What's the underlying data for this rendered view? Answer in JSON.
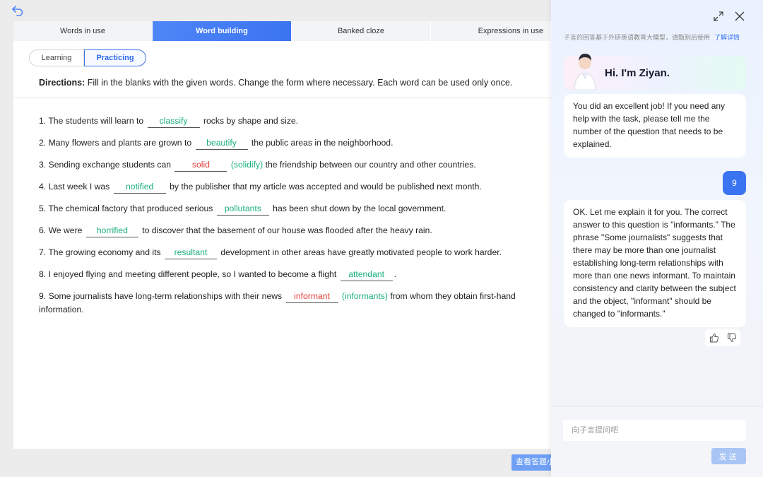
{
  "header": {
    "back_icon": "back-arrow-icon"
  },
  "tabs": [
    {
      "label": "Words in use",
      "active": false
    },
    {
      "label": "Word building",
      "active": true
    },
    {
      "label": "Banked cloze",
      "active": false
    },
    {
      "label": "Expressions in use",
      "active": false
    }
  ],
  "mode": {
    "learning": "Learning",
    "practicing": "Practicing",
    "selected": "Practicing"
  },
  "directions": {
    "label": "Directions:",
    "text": "Fill in the blanks with the given words. Change the form where necessary. Each word can be used only once."
  },
  "questions": [
    {
      "num": "1.",
      "before": "The students will learn to",
      "answer": "classify",
      "status": "correct",
      "correction": "",
      "after": "rocks by shape and size."
    },
    {
      "num": "2.",
      "before": "Many flowers and plants are grown to",
      "answer": "beautify",
      "status": "correct",
      "correction": "",
      "after": "the public areas in the neighborhood."
    },
    {
      "num": "3.",
      "before": "Sending exchange students can",
      "answer": "solid",
      "status": "wrong",
      "correction": "(solidify)",
      "after": "the friendship between our country and other countries."
    },
    {
      "num": "4.",
      "before": "Last week I was",
      "answer": "notified",
      "status": "correct",
      "correction": "",
      "after": "by the publisher that my article was accepted and would be published next month."
    },
    {
      "num": "5.",
      "before": "The chemical factory that produced serious",
      "answer": "pollutants",
      "status": "correct",
      "correction": "",
      "after": "has been shut down by the local government."
    },
    {
      "num": "6.",
      "before": "We were",
      "answer": "horrified",
      "status": "correct",
      "correction": "",
      "after": "to discover that the basement of our house was flooded after the heavy rain."
    },
    {
      "num": "7.",
      "before": "The growing economy and its",
      "answer": "resultant",
      "status": "correct",
      "correction": "",
      "after": "development in other areas have greatly motivated people to work harder."
    },
    {
      "num": "8.",
      "before": "I enjoyed flying and meeting different people, so I wanted to become a flight",
      "answer": "attendant",
      "status": "correct",
      "correction": "",
      "after": "."
    },
    {
      "num": "9.",
      "before": "Some journalists have long-term relationships with their news",
      "answer": "informant",
      "status": "wrong",
      "correction": "(informants)",
      "after": "from whom they obtain first-hand information."
    }
  ],
  "footer": {
    "check_button": "查看答题小"
  },
  "chat": {
    "disclaimer": "子言的回答基于外研英语教育大模型，请甄别后使用",
    "disclaimer_link": "了解详情",
    "greeting": "Hi. I'm Ziyan.",
    "messages": [
      {
        "role": "assistant",
        "text": "You did an excellent job! If you need any help with the task, please tell me the number of the question that needs to be explained."
      },
      {
        "role": "user",
        "text": "9"
      },
      {
        "role": "assistant",
        "text": "OK. Let me explain it for you. The correct answer to this question is \"informants.\" The phrase \"Some journalists\" suggests that there may be more than one journalist establishing long-term relationships with more than one news informant. To maintain consistency and clarity between the subject and the object, \"informant\" should be changed to \"informants.\""
      }
    ],
    "input_placeholder": "向子言提问吧",
    "send_label": "发送"
  },
  "colors": {
    "accent": "#3b74f0",
    "correct": "#1bb07a",
    "wrong": "#e2413d"
  }
}
